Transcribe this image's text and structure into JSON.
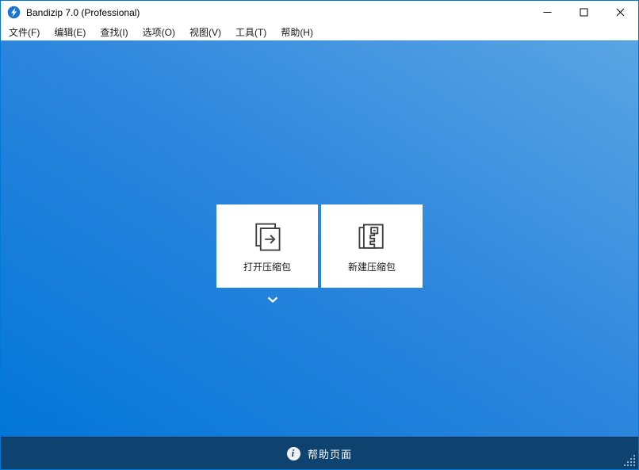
{
  "window": {
    "title": "Bandizip 7.0 (Professional)",
    "controls": [
      {
        "name": "minimize"
      },
      {
        "name": "maximize"
      },
      {
        "name": "close"
      }
    ]
  },
  "menu": {
    "items": [
      {
        "label": "文件(F)"
      },
      {
        "label": "编辑(E)"
      },
      {
        "label": "查找(I)"
      },
      {
        "label": "选项(O)"
      },
      {
        "label": "视图(V)"
      },
      {
        "label": "工具(T)"
      },
      {
        "label": "帮助(H)"
      }
    ]
  },
  "main": {
    "cards": [
      {
        "label": "打开压缩包",
        "icon": "open-archive-icon"
      },
      {
        "label": "新建压缩包",
        "icon": "new-archive-icon"
      }
    ],
    "recent_list_toggle_icon": "chevron-down-icon"
  },
  "statusbar": {
    "info_icon": "info-icon",
    "info_glyph": "i",
    "help_label": "帮助页面"
  },
  "icons": {
    "app_logo": "bandizip-logo",
    "resize_grip": "resize-grip-icon"
  },
  "colors": {
    "accent_border": "#0078d7",
    "dropzone_gradient_start": "#0276d8",
    "dropzone_gradient_end": "#5aa5e3",
    "statusbar_background": "#0e4370",
    "card_background": "#ffffff",
    "icon_stroke": "#3d3d3d"
  }
}
